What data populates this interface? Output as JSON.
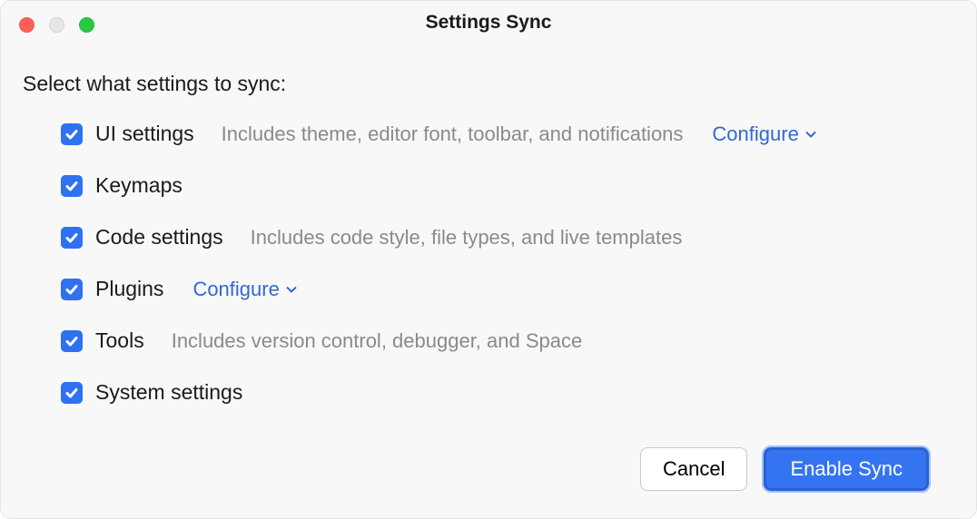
{
  "window": {
    "title": "Settings Sync"
  },
  "prompt": "Select what settings to sync:",
  "options": [
    {
      "label": "UI settings",
      "description": "Includes theme, editor font, toolbar, and notifications",
      "configure": "Configure",
      "checked": true
    },
    {
      "label": "Keymaps",
      "description": "",
      "configure": "",
      "checked": true
    },
    {
      "label": "Code settings",
      "description": "Includes code style, file types, and live templates",
      "configure": "",
      "checked": true
    },
    {
      "label": "Plugins",
      "description": "",
      "configure": "Configure",
      "checked": true
    },
    {
      "label": "Tools",
      "description": "Includes version control, debugger, and Space",
      "configure": "",
      "checked": true
    },
    {
      "label": "System settings",
      "description": "",
      "configure": "",
      "checked": true
    }
  ],
  "buttons": {
    "cancel": "Cancel",
    "confirm": "Enable Sync"
  }
}
